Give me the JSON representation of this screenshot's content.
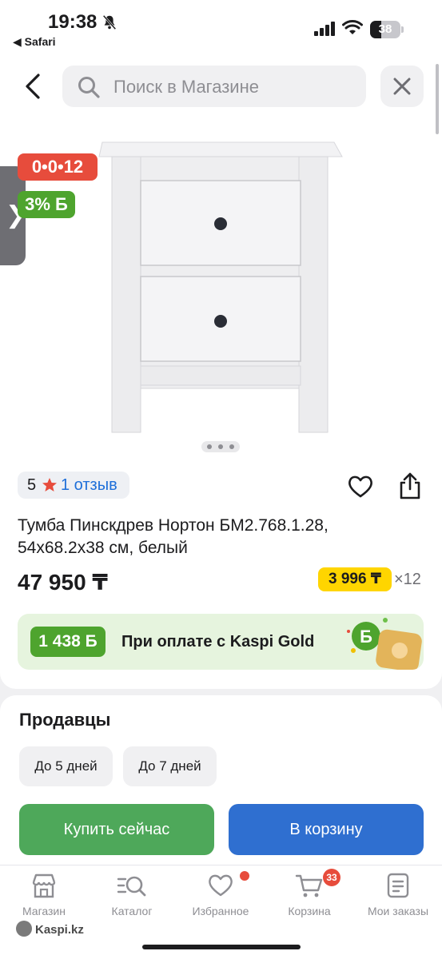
{
  "status_bar": {
    "time": "19:38",
    "back_app": "◀ Safari",
    "battery": "38",
    "battery_level": 0.38
  },
  "search": {
    "placeholder": "Поиск в Магазине"
  },
  "badges": {
    "timer": "0•0•12",
    "bonus_percent": "3% Б"
  },
  "gallery": {
    "pages": 3,
    "active": 0
  },
  "rating": {
    "score": "5",
    "reviews": "1 отзыв"
  },
  "product": {
    "title": "Тумба Пинскдрев Нортон БМ2.768.1.28, 54х68.2х38 см, белый",
    "price": "47 950 ₸",
    "installment": "3 996 ₸",
    "installment_multiplier": "×12"
  },
  "bonus": {
    "amount": "1 438 Б",
    "text": "При оплате с Kaspi Gold"
  },
  "sellers": {
    "title": "Продавцы",
    "filters": [
      "До 5 дней",
      "До 7 дней"
    ]
  },
  "actions": {
    "buy": "Купить сейчас",
    "cart": "В корзину"
  },
  "tabbar": {
    "items": [
      {
        "label": "Магазин",
        "icon": "store-icon"
      },
      {
        "label": "Каталог",
        "icon": "catalog-search-icon"
      },
      {
        "label": "Избранное",
        "icon": "heart-icon"
      },
      {
        "label": "Корзина",
        "icon": "cart-icon"
      },
      {
        "label": "Мои заказы",
        "icon": "orders-icon"
      }
    ],
    "cart_count": "33"
  },
  "watermark": "Kaspi.kz",
  "colors": {
    "accent_green": "#4ea42e",
    "accent_blue": "#2f6fd0",
    "badge_red": "#e74c3c",
    "installment_yellow": "#ffd500"
  }
}
